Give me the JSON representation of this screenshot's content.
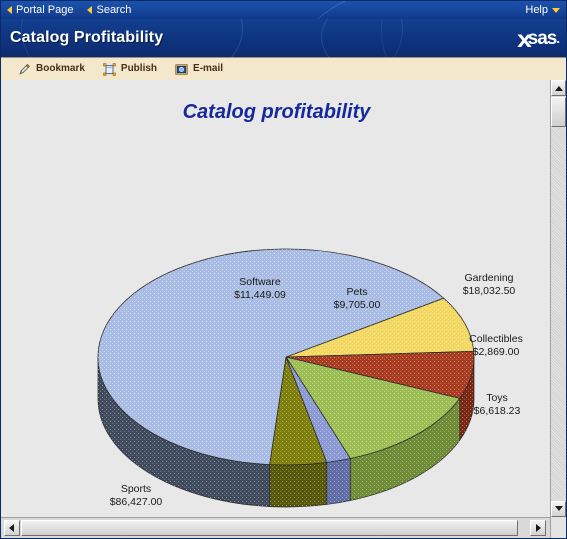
{
  "topnav": {
    "links": [
      {
        "label": "Portal Page",
        "icon": "triangle-left-icon"
      },
      {
        "label": "Search",
        "icon": "triangle-left-icon"
      }
    ],
    "help_label": "Help",
    "help_icon": "chevron-down-icon"
  },
  "banner": {
    "title": "Catalog Profitability",
    "logo_text": "sas",
    "logo_dot": ".",
    "bg_color": "#0f3784"
  },
  "toolbar": {
    "items": [
      {
        "label": "Bookmark",
        "icon": "bookmark-pen-icon"
      },
      {
        "label": "Publish",
        "icon": "publish-frame-icon"
      },
      {
        "label": "E-mail",
        "icon": "email-icon"
      }
    ],
    "bg_color": "#f4e8cc",
    "text_color": "#4a2d12"
  },
  "chart_data": {
    "type": "pie",
    "title": "Catalog profitability",
    "title_color": "#16299c",
    "xlabel": "",
    "ylabel": "",
    "legend_position": "none",
    "grid": false,
    "currency": "$",
    "categories": [
      "Software",
      "Pets",
      "Gardening",
      "Collectibles",
      "Toys",
      "Sports"
    ],
    "values": [
      11449.09,
      9705.0,
      18032.5,
      2869.0,
      6618.23,
      86427.0
    ],
    "value_labels": [
      "$11,449.09",
      "$9,705.00",
      "$18,032.50",
      "$2,869.00",
      "$6,618.23",
      "$86,427.00"
    ],
    "colors": [
      "#f2d761",
      "#a83a20",
      "#9bbd52",
      "#8a99d4",
      "#7d7d0a",
      "#a8bce4"
    ],
    "side_colors": [
      "#b9a23d",
      "#7a2712",
      "#6f8a35",
      "#5f6ca6",
      "#565608",
      "#3e4a5c"
    ],
    "slices": [
      {
        "label": "Software",
        "value": 11449.09,
        "value_label": "$11,449.09",
        "color": "#f2d761",
        "side_color": "#b9a23d",
        "start_deg": 327.0,
        "end_deg": 357.0
      },
      {
        "label": "Pets",
        "value": 9705.0,
        "value_label": "$9,705.00",
        "color": "#a83a20",
        "side_color": "#7a2712",
        "start_deg": 357.0,
        "end_deg": 22.5
      },
      {
        "label": "Gardening",
        "value": 18032.5,
        "value_label": "$18,032.50",
        "color": "#9bbd52",
        "side_color": "#6f8a35",
        "start_deg": 22.5,
        "end_deg": 70.0
      },
      {
        "label": "Collectibles",
        "value": 2869.0,
        "value_label": "$2,869.00",
        "color": "#8a99d4",
        "side_color": "#5f6ca6",
        "start_deg": 70.0,
        "end_deg": 77.5
      },
      {
        "label": "Toys",
        "value": 6618.23,
        "value_label": "$6,618.23",
        "color": "#7d7d0a",
        "side_color": "#565608",
        "start_deg": 77.5,
        "end_deg": 95.0
      },
      {
        "label": "Sports",
        "value": 86427.0,
        "value_label": "$86,427.00",
        "color": "#a8bce4",
        "side_color": "#3e4a5c",
        "start_deg": 95.0,
        "end_deg": 327.0
      }
    ]
  },
  "scrollbars": {
    "vertical": {
      "up_icon": "arrow-up-icon",
      "down_icon": "arrow-down-icon"
    },
    "horizontal": {
      "left_icon": "arrow-left-icon",
      "right_icon": "arrow-right-icon"
    }
  }
}
